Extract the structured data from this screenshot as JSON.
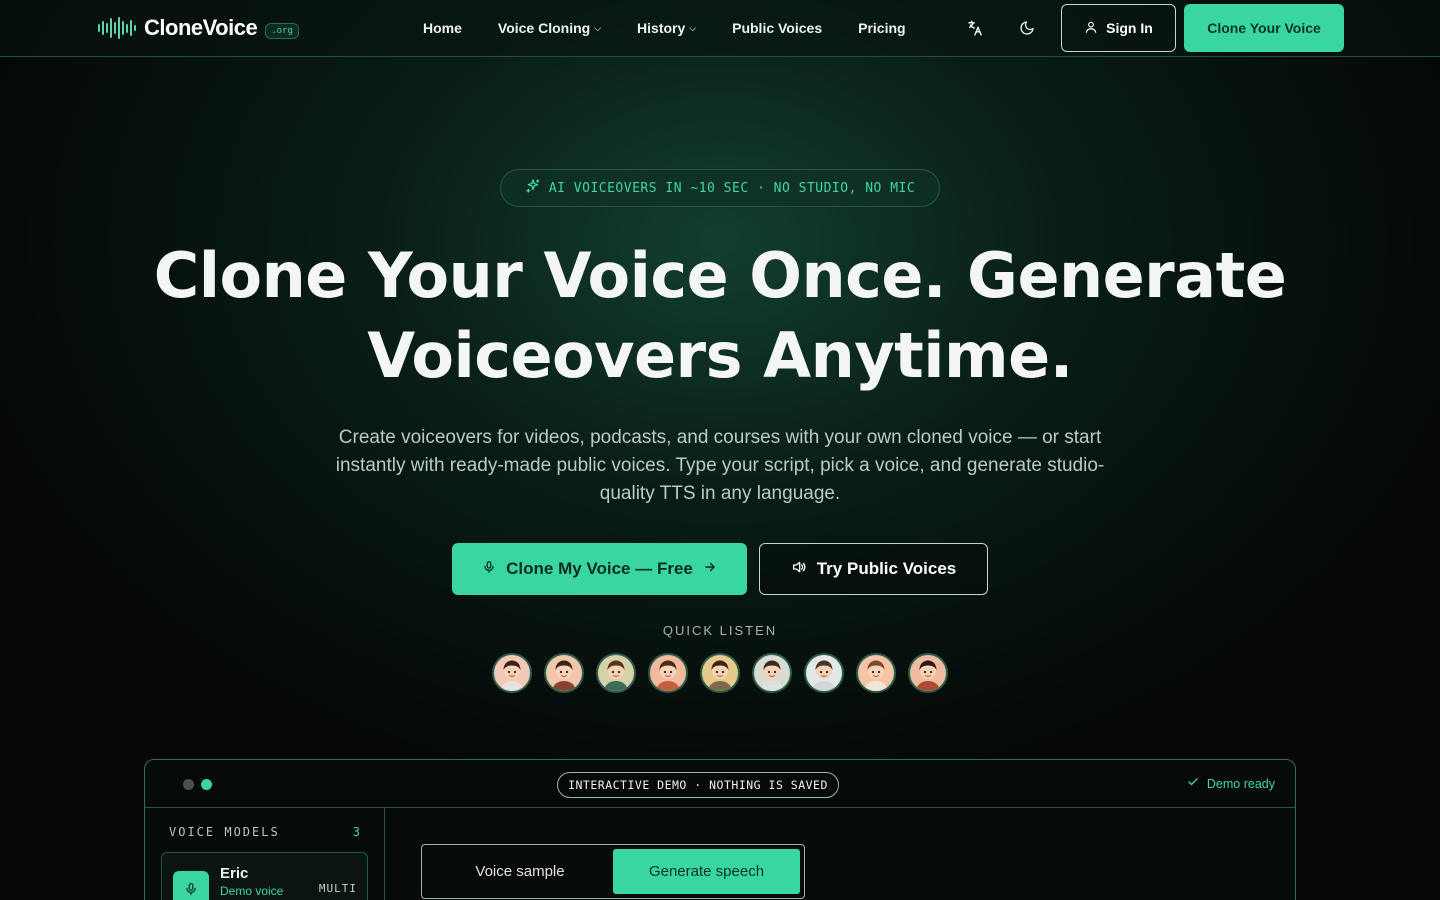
{
  "brand": {
    "name": "CloneVoice",
    "tld": ".org"
  },
  "nav": {
    "items": [
      {
        "label": "Home",
        "dropdown": false
      },
      {
        "label": "Voice Cloning",
        "dropdown": true
      },
      {
        "label": "History",
        "dropdown": true
      },
      {
        "label": "Public Voices",
        "dropdown": false
      },
      {
        "label": "Pricing",
        "dropdown": false
      }
    ],
    "translate_icon": "translate-icon",
    "theme_icon": "moon-icon",
    "signin_label": "Sign In",
    "clone_label": "Clone Your Voice"
  },
  "hero": {
    "badge": "AI VOICEOVERS IN ~10 SEC · NO STUDIO, NO MIC",
    "headline_line1": "Clone Your Voice Once. Generate",
    "headline_line2": "Voiceovers Anytime.",
    "subtitle": "Create voiceovers for videos, podcasts, and courses with your own cloned voice — or start instantly with ready-made public voices. Type your script, pick a voice, and generate studio-quality TTS in any language.",
    "cta_primary": "Clone My Voice — Free",
    "cta_secondary": "Try Public Voices",
    "quick_listen_label": "QUICK LISTEN",
    "avatars": [
      {
        "bg": "#f1c9b5",
        "hair": "#3a2118",
        "shirt": "#e7e2de"
      },
      {
        "bg": "#f0c7ad",
        "hair": "#3b2316",
        "shirt": "#8a4230"
      },
      {
        "bg": "#d7d1a7",
        "hair": "#5a341c",
        "shirt": "#3f6b5a"
      },
      {
        "bg": "#f2b99d",
        "hair": "#4a2a1c",
        "shirt": "#c25f3e"
      },
      {
        "bg": "#e9c98a",
        "hair": "#3b2414",
        "shirt": "#7b6a4a"
      },
      {
        "bg": "#d8dcd3",
        "hair": "#3a2a20",
        "shirt": "#dfe3df"
      },
      {
        "bg": "#e3e7ea",
        "hair": "#4a3324",
        "shirt": "#cfd7dd"
      },
      {
        "bg": "#f3c4a6",
        "hair": "#7a4a2c",
        "shirt": "#f0e6da"
      },
      {
        "bg": "#f0bca1",
        "hair": "#2e1a12",
        "shirt": "#a84d33"
      }
    ]
  },
  "demo": {
    "tag": "INTERACTIVE DEMO · NOTHING IS SAVED",
    "status": "Demo ready",
    "sidebar_title": "VOICE MODELS",
    "model_count": "3",
    "model": {
      "name": "Eric",
      "subtitle": "Demo voice",
      "language": "MULTI"
    },
    "tabs": [
      "Voice sample",
      "Generate speech"
    ],
    "active_tab": "Generate speech"
  },
  "colors": {
    "accent": "#3ad6a0",
    "accent_text": "#3fd6a4",
    "background": "#050807",
    "border": "#245545"
  }
}
